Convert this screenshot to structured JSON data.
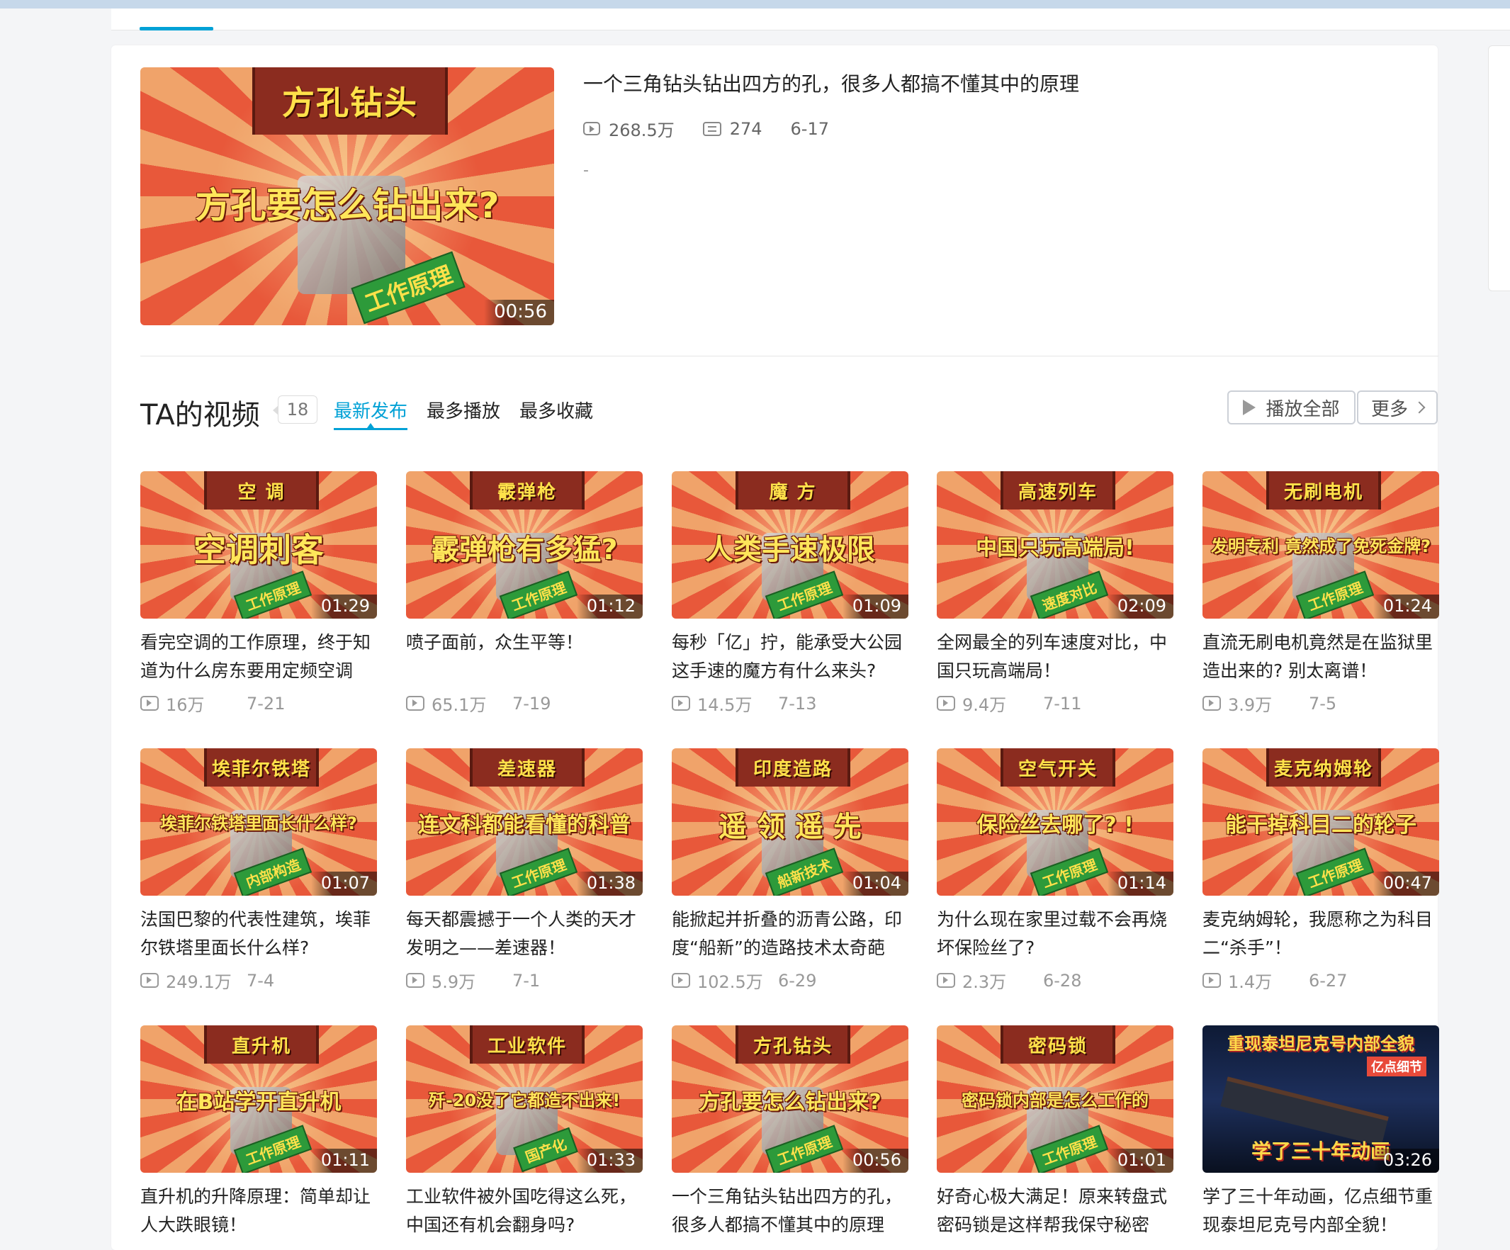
{
  "featured": {
    "title": "一个三角钻头钻出四方的孔，很多人都搞不懂其中的原理",
    "plays": "268.5万",
    "danmaku": "274",
    "date": "6-17",
    "desc": "-",
    "duration": "00:56",
    "thumb_top": "方孔钻头",
    "thumb_mid": "方孔要怎么钻出来?",
    "thumb_ribbon": "工作原理"
  },
  "section": {
    "title": "TA的视频",
    "count": "18",
    "tabs": [
      "最新发布",
      "最多播放",
      "最多收藏"
    ],
    "play_all": "播放全部",
    "more": "更多"
  },
  "videos": [
    {
      "top": "空 调",
      "mid": "空调刺客",
      "ribbon": "工作原理",
      "duration": "01:29",
      "title": "看完空调的工作原理，终于知道为什么房东要用定频空调",
      "plays": "16万",
      "date": "7-21"
    },
    {
      "top": "霰弹枪",
      "mid": "霰弹枪有多猛?",
      "ribbon": "工作原理",
      "duration": "01:12",
      "title": "喷子面前，众生平等！",
      "plays": "65.1万",
      "date": "7-19"
    },
    {
      "top": "魔 方",
      "mid": "人类手速极限",
      "ribbon": "工作原理",
      "duration": "01:09",
      "title": "每秒「亿」拧，能承受大公园这手速的魔方有什么来头?",
      "plays": "14.5万",
      "date": "7-13"
    },
    {
      "top": "高速列车",
      "mid": "中国只玩高端局!",
      "ribbon": "速度对比",
      "duration": "02:09",
      "title": "全网最全的列车速度对比，中国只玩高端局！",
      "plays": "9.4万",
      "date": "7-11"
    },
    {
      "top": "无刷电机",
      "mid": "发明专利 竟然成了免死金牌?",
      "ribbon": "工作原理",
      "duration": "01:24",
      "title": "直流无刷电机竟然是在监狱里造出来的? 别太离谱！",
      "plays": "3.9万",
      "date": "7-5"
    },
    {
      "top": "埃菲尔铁塔",
      "mid": "埃菲尔铁塔里面长什么样?",
      "ribbon": "内部构造",
      "duration": "01:07",
      "title": "法国巴黎的代表性建筑，埃菲尔铁塔里面长什么样?",
      "plays": "249.1万",
      "date": "7-4"
    },
    {
      "top": "差速器",
      "mid": "连文科都能看懂的科普",
      "ribbon": "工作原理",
      "duration": "01:38",
      "title": "每天都震撼于一个人类的天才发明之——差速器！",
      "plays": "5.9万",
      "date": "7-1"
    },
    {
      "top": "印度造路",
      "mid": "遥 领 遥 先",
      "ribbon": "船新技术",
      "duration": "01:04",
      "title": "能掀起并折叠的沥青公路，印度“船新”的造路技术太奇葩",
      "plays": "102.5万",
      "date": "6-29"
    },
    {
      "top": "空气开关",
      "mid": "保险丝去哪了? !",
      "ribbon": "工作原理",
      "duration": "01:14",
      "title": "为什么现在家里过载不会再烧坏保险丝了?",
      "plays": "2.3万",
      "date": "6-28"
    },
    {
      "top": "麦克纳姆轮",
      "mid": "能干掉科目二的轮子",
      "ribbon": "工作原理",
      "duration": "00:47",
      "title": "麦克纳姆轮，我愿称之为科目二“杀手”！",
      "plays": "1.4万",
      "date": "6-27"
    },
    {
      "top": "直升机",
      "mid": "在B站学开直升机",
      "ribbon": "工作原理",
      "duration": "01:11",
      "title": "直升机的升降原理：简单却让人大跌眼镜！",
      "plays": "",
      "date": ""
    },
    {
      "top": "工业软件",
      "mid": "歼-20没了它都造不出来!",
      "ribbon": "国产化",
      "duration": "01:33",
      "title": "工业软件被外国吃得这么死，中国还有机会翻身吗?",
      "plays": "",
      "date": ""
    },
    {
      "top": "方孔钻头",
      "mid": "方孔要怎么钻出来?",
      "ribbon": "工作原理",
      "duration": "00:56",
      "title": "一个三角钻头钻出四方的孔，很多人都搞不懂其中的原理",
      "plays": "",
      "date": ""
    },
    {
      "top": "密码锁",
      "mid": "密码锁内部是怎么工作的",
      "ribbon": "工作原理",
      "duration": "01:01",
      "title": "好奇心极大满足！原来转盘式密码锁是这样帮我保守秘密",
      "plays": "",
      "date": ""
    },
    {
      "top": "重现泰坦尼克号内部全貌",
      "mid": "亿点细节",
      "ribbon": "学了三十年动画",
      "duration": "03:26",
      "title": "学了三十年动画，亿点细节重现泰坦尼克号内部全貌！",
      "plays": "",
      "date": "",
      "dark": true
    }
  ]
}
